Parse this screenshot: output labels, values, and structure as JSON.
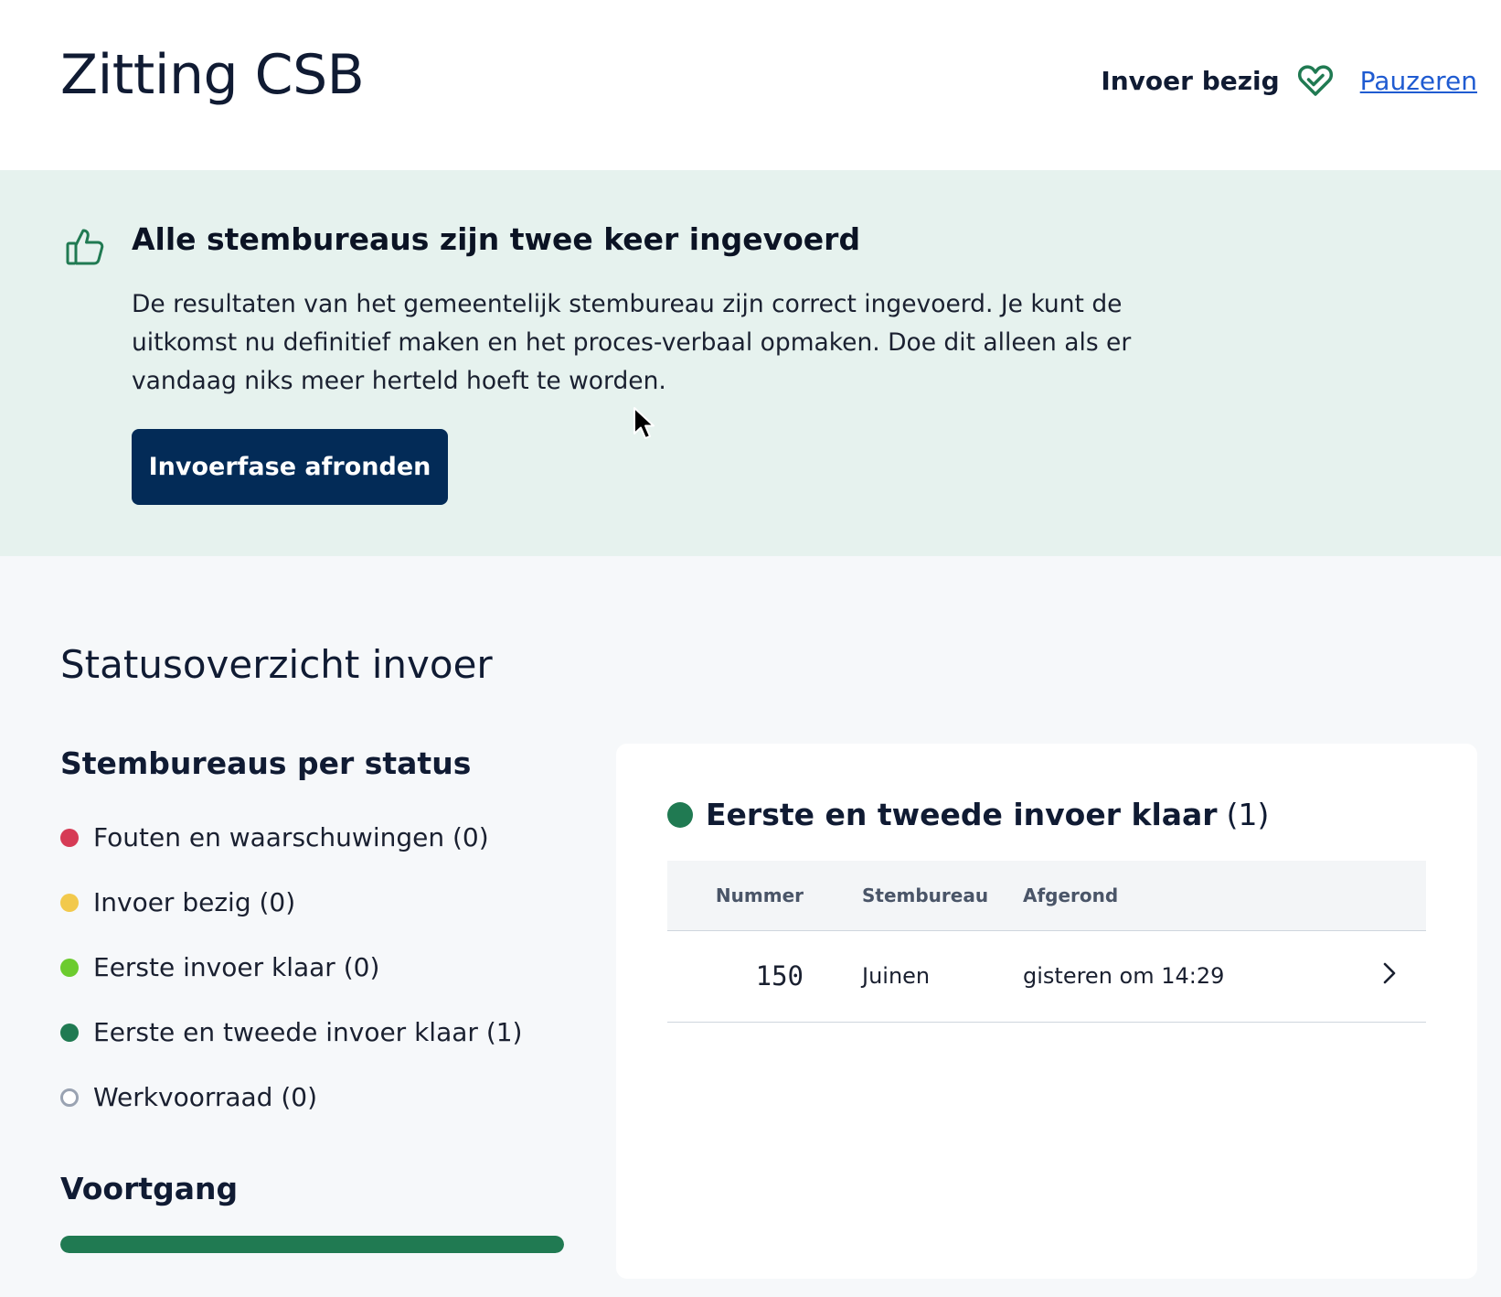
{
  "header": {
    "title": "Zitting CSB",
    "status_text": "Invoer bezig",
    "pause_link": "Pauzeren"
  },
  "banner": {
    "title": "Alle stembureaus zijn twee keer ingevoerd",
    "text": "De resultaten van het gemeentelijk stembureau zijn correct ingevoerd. Je kunt de uitkomst nu definitief maken en het proces-verbaal opmaken. Doe dit alleen als er vandaag niks meer herteld hoeft te worden.",
    "button_label": "Invoerfase afronden"
  },
  "overview": {
    "title": "Statusoverzicht invoer",
    "per_status_title": "Stembureaus per status",
    "statuses": [
      {
        "label": "Fouten en waarschuwingen (0)",
        "color": "#d63b55"
      },
      {
        "label": "Invoer bezig (0)",
        "color": "#f2c94c"
      },
      {
        "label": "Eerste invoer klaar (0)",
        "color": "#6ccb2e"
      },
      {
        "label": "Eerste en tweede invoer klaar (1)",
        "color": "#207a52"
      },
      {
        "label": "Werkvoorraad (0)",
        "color": "hollow"
      }
    ],
    "progress_title": "Voortgang",
    "progress_fraction": 1.0
  },
  "card": {
    "title": "Eerste en tweede invoer klaar",
    "count": "(1)",
    "dot_color": "#207a52",
    "columns": [
      "Nummer",
      "Stembureau",
      "Afgerond"
    ],
    "rows": [
      {
        "number": "150",
        "station": "Juinen",
        "finished": "gisteren om 14:29"
      }
    ]
  }
}
